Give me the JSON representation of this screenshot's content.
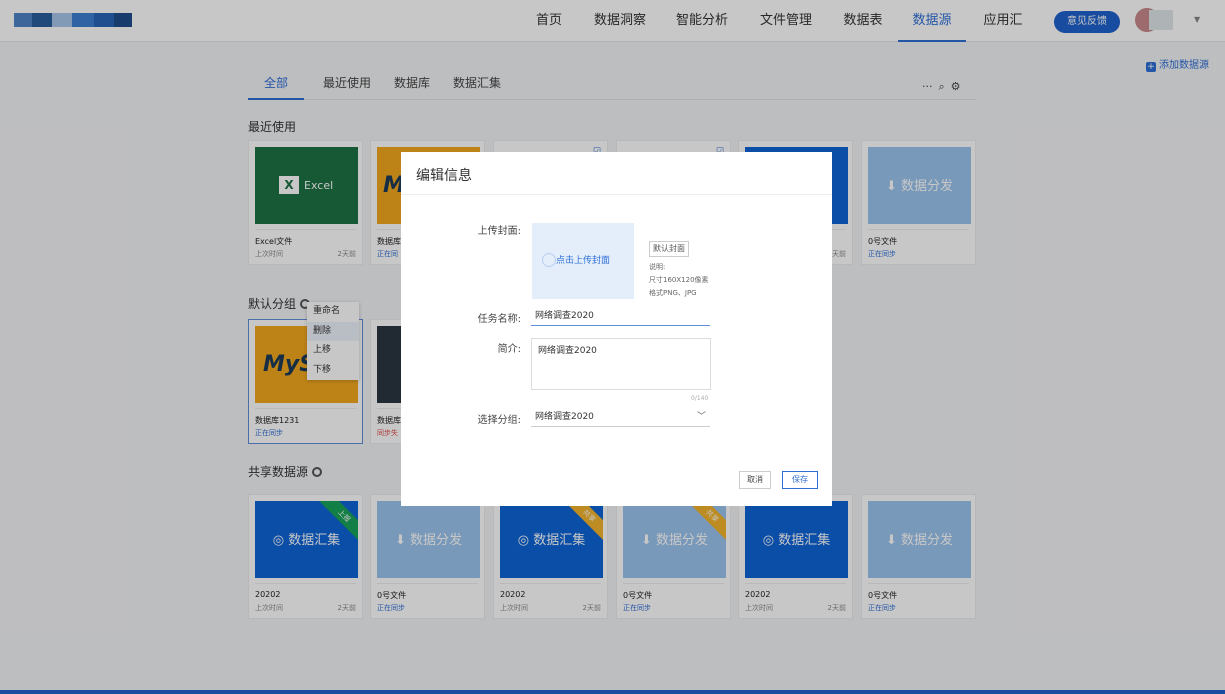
{
  "nav": {
    "items": [
      "首页",
      "数据洞察",
      "智能分析",
      "文件管理",
      "数据表",
      "数据源",
      "应用汇"
    ],
    "active": "数据源",
    "feedback": "意见反馈"
  },
  "add_source": "添加数据源",
  "tabs": [
    "全部",
    "最近使用",
    "数据库",
    "数据汇集"
  ],
  "sections": {
    "recent": "最近使用",
    "default_group": "默认分组",
    "shared": "共享数据源"
  },
  "recent_cards": [
    {
      "thumb_text": "Excel",
      "name": "Excel文件",
      "desc": "上次时间",
      "time": "2天前"
    },
    {
      "thumb_text": "M",
      "name": "数据库",
      "desc": "正在同",
      "time": ""
    },
    {
      "name": "",
      "desc": "",
      "time": ""
    },
    {
      "name": "",
      "desc": "",
      "time": ""
    },
    {
      "name": "",
      "desc": "",
      "time": "天前"
    },
    {
      "thumb_text": "数据分发",
      "name": "0号文件",
      "desc": "正在同步",
      "time": ""
    }
  ],
  "default_cards": [
    {
      "thumb_text": "MyS",
      "name": "数据库1231",
      "desc": "正在同步"
    },
    {
      "name": "数据库",
      "desc": "同步失"
    }
  ],
  "context_menu": [
    "重命名",
    "删除",
    "上移",
    "下移"
  ],
  "shared_cards": [
    {
      "thumb_text": "数据汇集",
      "name": "20202",
      "desc": "上次时间",
      "time": "2天前",
      "ribbon": "上报"
    },
    {
      "thumb_text": "数据分发",
      "name": "0号文件",
      "desc": "正在同步",
      "time": ""
    },
    {
      "thumb_text": "数据汇集",
      "name": "20202",
      "desc": "上次时间",
      "time": "2天前",
      "ribbon": "共享"
    },
    {
      "thumb_text": "数据分发",
      "name": "0号文件",
      "desc": "正在同步",
      "time": "",
      "ribbon": "共享"
    },
    {
      "thumb_text": "数据汇集",
      "name": "20202",
      "desc": "上次时间",
      "time": "2天前"
    },
    {
      "thumb_text": "数据分发",
      "name": "0号文件",
      "desc": "正在同步",
      "time": ""
    }
  ],
  "modal": {
    "title": "编辑信息",
    "upload_label": "上传封面:",
    "upload_text": "点击上传封面",
    "default_cover": "默认封面",
    "notes": [
      "说明:",
      "尺寸160X120像素",
      "格式PNG、JPG"
    ],
    "task_label": "任务名称:",
    "task_value": "网络调查2020",
    "intro_label": "简介:",
    "intro_value": "网络调查2020",
    "count": "0/140",
    "group_label": "选择分组:",
    "group_value": "网络调查2020",
    "cancel": "取消",
    "save": "保存"
  },
  "colors": {
    "accent": "#2f6fd6",
    "excel": "#1e7145",
    "mysql": "#f2a81e",
    "collect": "#0f65d8",
    "distribute": "#9cc4ef"
  }
}
